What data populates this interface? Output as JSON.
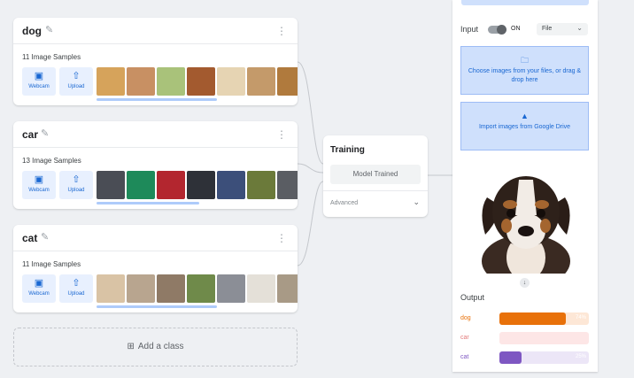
{
  "classes": [
    {
      "name": "dog",
      "samples_label": "11 Image Samples",
      "webcam_label": "Webcam",
      "upload_label": "Upload",
      "thumb_colors": [
        "#d6a35b",
        "#c89063",
        "#a9c27a",
        "#a35a2f",
        "#e6d4b3",
        "#c49a6a",
        "#b07a3d"
      ]
    },
    {
      "name": "car",
      "samples_label": "13 Image Samples",
      "webcam_label": "Webcam",
      "upload_label": "Upload",
      "thumb_colors": [
        "#4a4d55",
        "#1e8a5a",
        "#b3262f",
        "#2e3138",
        "#3c4f7a",
        "#6b7a3a",
        "#5a5d63"
      ]
    },
    {
      "name": "cat",
      "samples_label": "11 Image Samples",
      "webcam_label": "Webcam",
      "upload_label": "Upload",
      "thumb_colors": [
        "#d9c3a5",
        "#b8a58f",
        "#8f7a66",
        "#6f8a4a",
        "#8b8e96",
        "#e4e0d8",
        "#a89a86"
      ]
    }
  ],
  "add_class_label": "Add a class",
  "training": {
    "title": "Training",
    "button_label": "Model Trained",
    "advanced_label": "Advanced"
  },
  "preview": {
    "input_label": "Input",
    "toggle_label": "ON",
    "source_select": "File",
    "upload_box_text": "Choose images from your files, or drag & drop here",
    "drive_box_text": "Import images from Google Drive",
    "output_label": "Output",
    "outputs": [
      {
        "name": "dog",
        "value": 0.74,
        "pct_label": "74%",
        "color": "#e8710a",
        "track": "#fde7d6"
      },
      {
        "name": "car",
        "value": 0.0,
        "pct_label": "",
        "color": "#e37a7a",
        "track": "#fde6e6"
      },
      {
        "name": "cat",
        "value": 0.25,
        "pct_label": "25%",
        "color": "#7e57c2",
        "track": "#ece6f7"
      }
    ]
  },
  "colors": {
    "accent_blue": "#1967d2",
    "drop_box_bg": "#cfe0fc"
  }
}
